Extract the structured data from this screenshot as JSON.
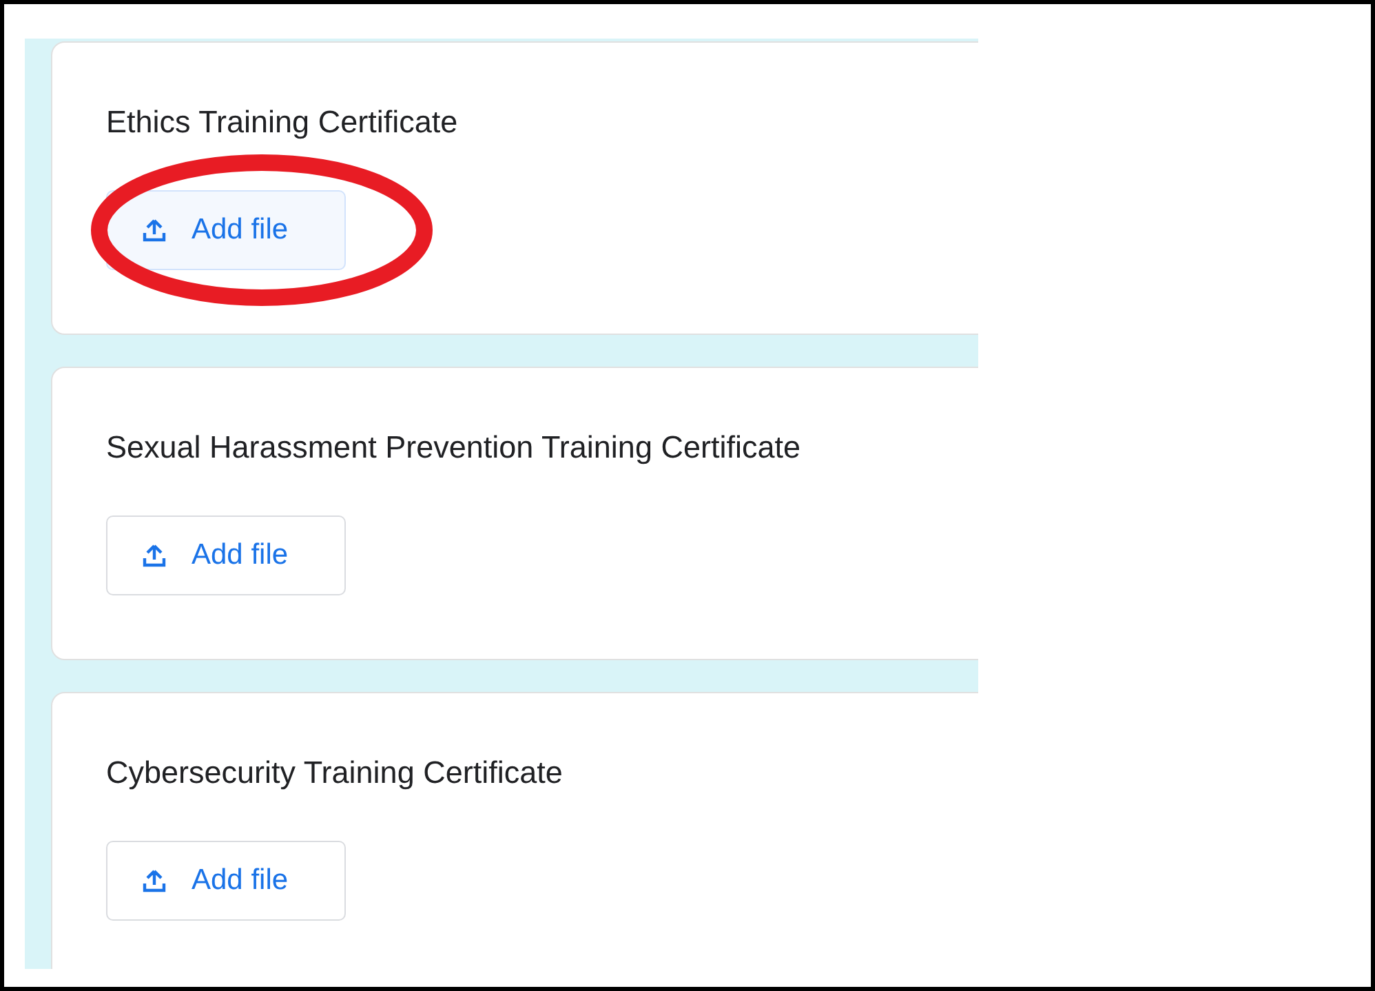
{
  "questions": [
    {
      "title": "Ethics Training Certificate",
      "button": {
        "label": "Add file",
        "highlighted": true,
        "circled": true
      }
    },
    {
      "title": "Sexual Harassment Prevention Training Certificate",
      "button": {
        "label": "Add file",
        "highlighted": false,
        "circled": false
      }
    },
    {
      "title": "Cybersecurity Training Certificate",
      "button": {
        "label": "Add file",
        "highlighted": false,
        "circled": false
      }
    }
  ]
}
